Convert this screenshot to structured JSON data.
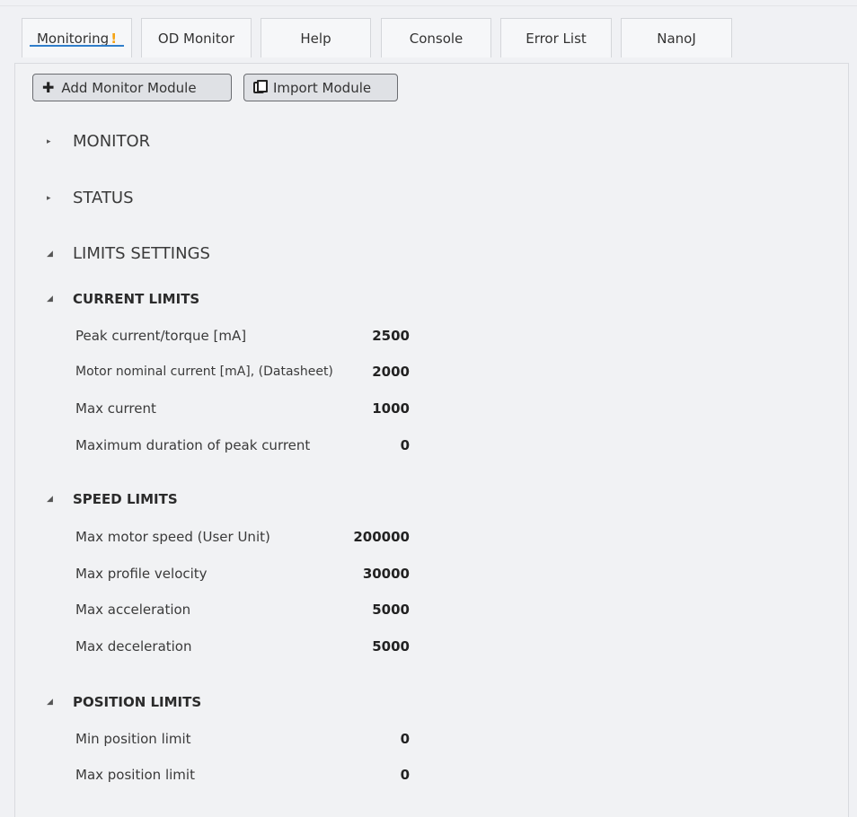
{
  "tabs": [
    {
      "label": "Monitoring",
      "warning": "!"
    },
    {
      "label": "OD Monitor"
    },
    {
      "label": "Help"
    },
    {
      "label": "Console"
    },
    {
      "label": "Error List"
    },
    {
      "label": "NanoJ"
    }
  ],
  "toolbar": {
    "add_label": "Add Monitor Module",
    "import_label": "Import Module"
  },
  "sections": {
    "monitor": "MONITOR",
    "status": "STATUS",
    "limits": "LIMITS SETTINGS"
  },
  "current_limits": {
    "title": "CURRENT LIMITS",
    "rows": [
      {
        "label": "Peak current/torque [mA]",
        "value": "2500"
      },
      {
        "label": "Motor nominal current [mA], (Datasheet)",
        "value": "2000"
      },
      {
        "label": "Max current",
        "value": "1000"
      },
      {
        "label": "Maximum duration of peak current",
        "value": "0"
      }
    ]
  },
  "speed_limits": {
    "title": "SPEED LIMITS",
    "rows": [
      {
        "label": "Max motor speed (User Unit)",
        "value": "200000"
      },
      {
        "label": "Max profile velocity",
        "value": "30000"
      },
      {
        "label": "Max acceleration",
        "value": "5000"
      },
      {
        "label": "Max deceleration",
        "value": "5000"
      }
    ]
  },
  "position_limits": {
    "title": "POSITION LIMITS",
    "rows": [
      {
        "label": "Min position limit",
        "value": "0"
      },
      {
        "label": "Max position limit",
        "value": "0"
      }
    ]
  },
  "colors": {
    "accent": "#2f7ecb",
    "warning": "#f5a313",
    "background": "#f0f1f4"
  }
}
